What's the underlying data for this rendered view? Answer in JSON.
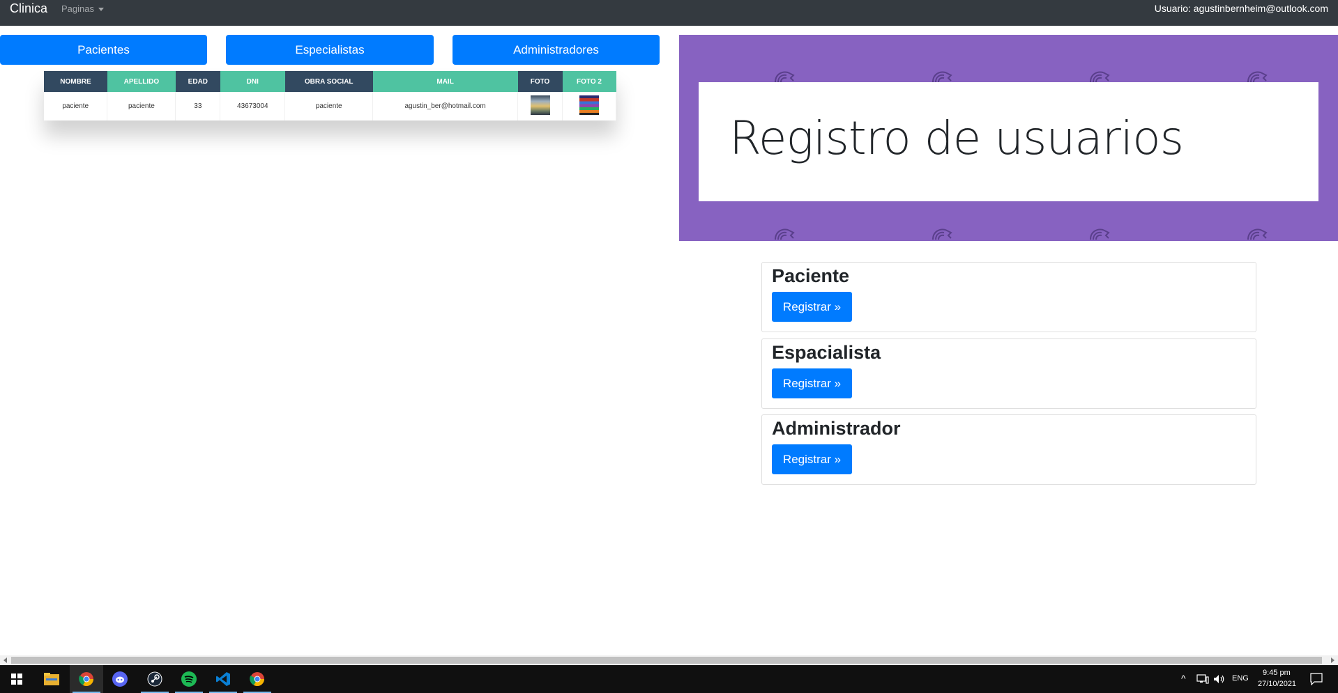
{
  "navbar": {
    "brand": "Clinica",
    "pages_menu": "Paginas",
    "user_label": "Usuario: agustinbernheim@outlook.com"
  },
  "top_buttons": {
    "pacientes": "Pacientes",
    "especialistas": "Especialistas",
    "administradores": "Administradores"
  },
  "table": {
    "headers": [
      "NOMBRE",
      "APELLIDO",
      "EDAD",
      "DNI",
      "OBRA SOCIAL",
      "MAIL",
      "FOTO",
      "FOTO 2"
    ],
    "rows": [
      {
        "nombre": "paciente",
        "apellido": "paciente",
        "edad": "33",
        "dni": "43673004",
        "obra_social": "paciente",
        "mail": "agustin_ber@hotmail.com"
      }
    ]
  },
  "hero": {
    "title": "Registro de usuarios",
    "background_color": "#8762c1"
  },
  "cards": [
    {
      "title": "Paciente",
      "button": "Registrar »"
    },
    {
      "title": "Espacialista",
      "button": "Registrar »"
    },
    {
      "title": "Administrador",
      "button": "Registrar »"
    }
  ],
  "colors": {
    "primary": "#007bff",
    "navbar": "#343a40",
    "table_dark": "#324960",
    "table_green": "#4fc3a1"
  },
  "taskbar": {
    "apps": [
      "windows-start-icon",
      "file-explorer-icon",
      "chrome-icon",
      "discord-icon",
      "steam-icon",
      "spotify-icon",
      "vscode-icon",
      "chrome-icon"
    ],
    "language": "ENG",
    "time": "9:45 pm",
    "date": "27/10/2021"
  }
}
